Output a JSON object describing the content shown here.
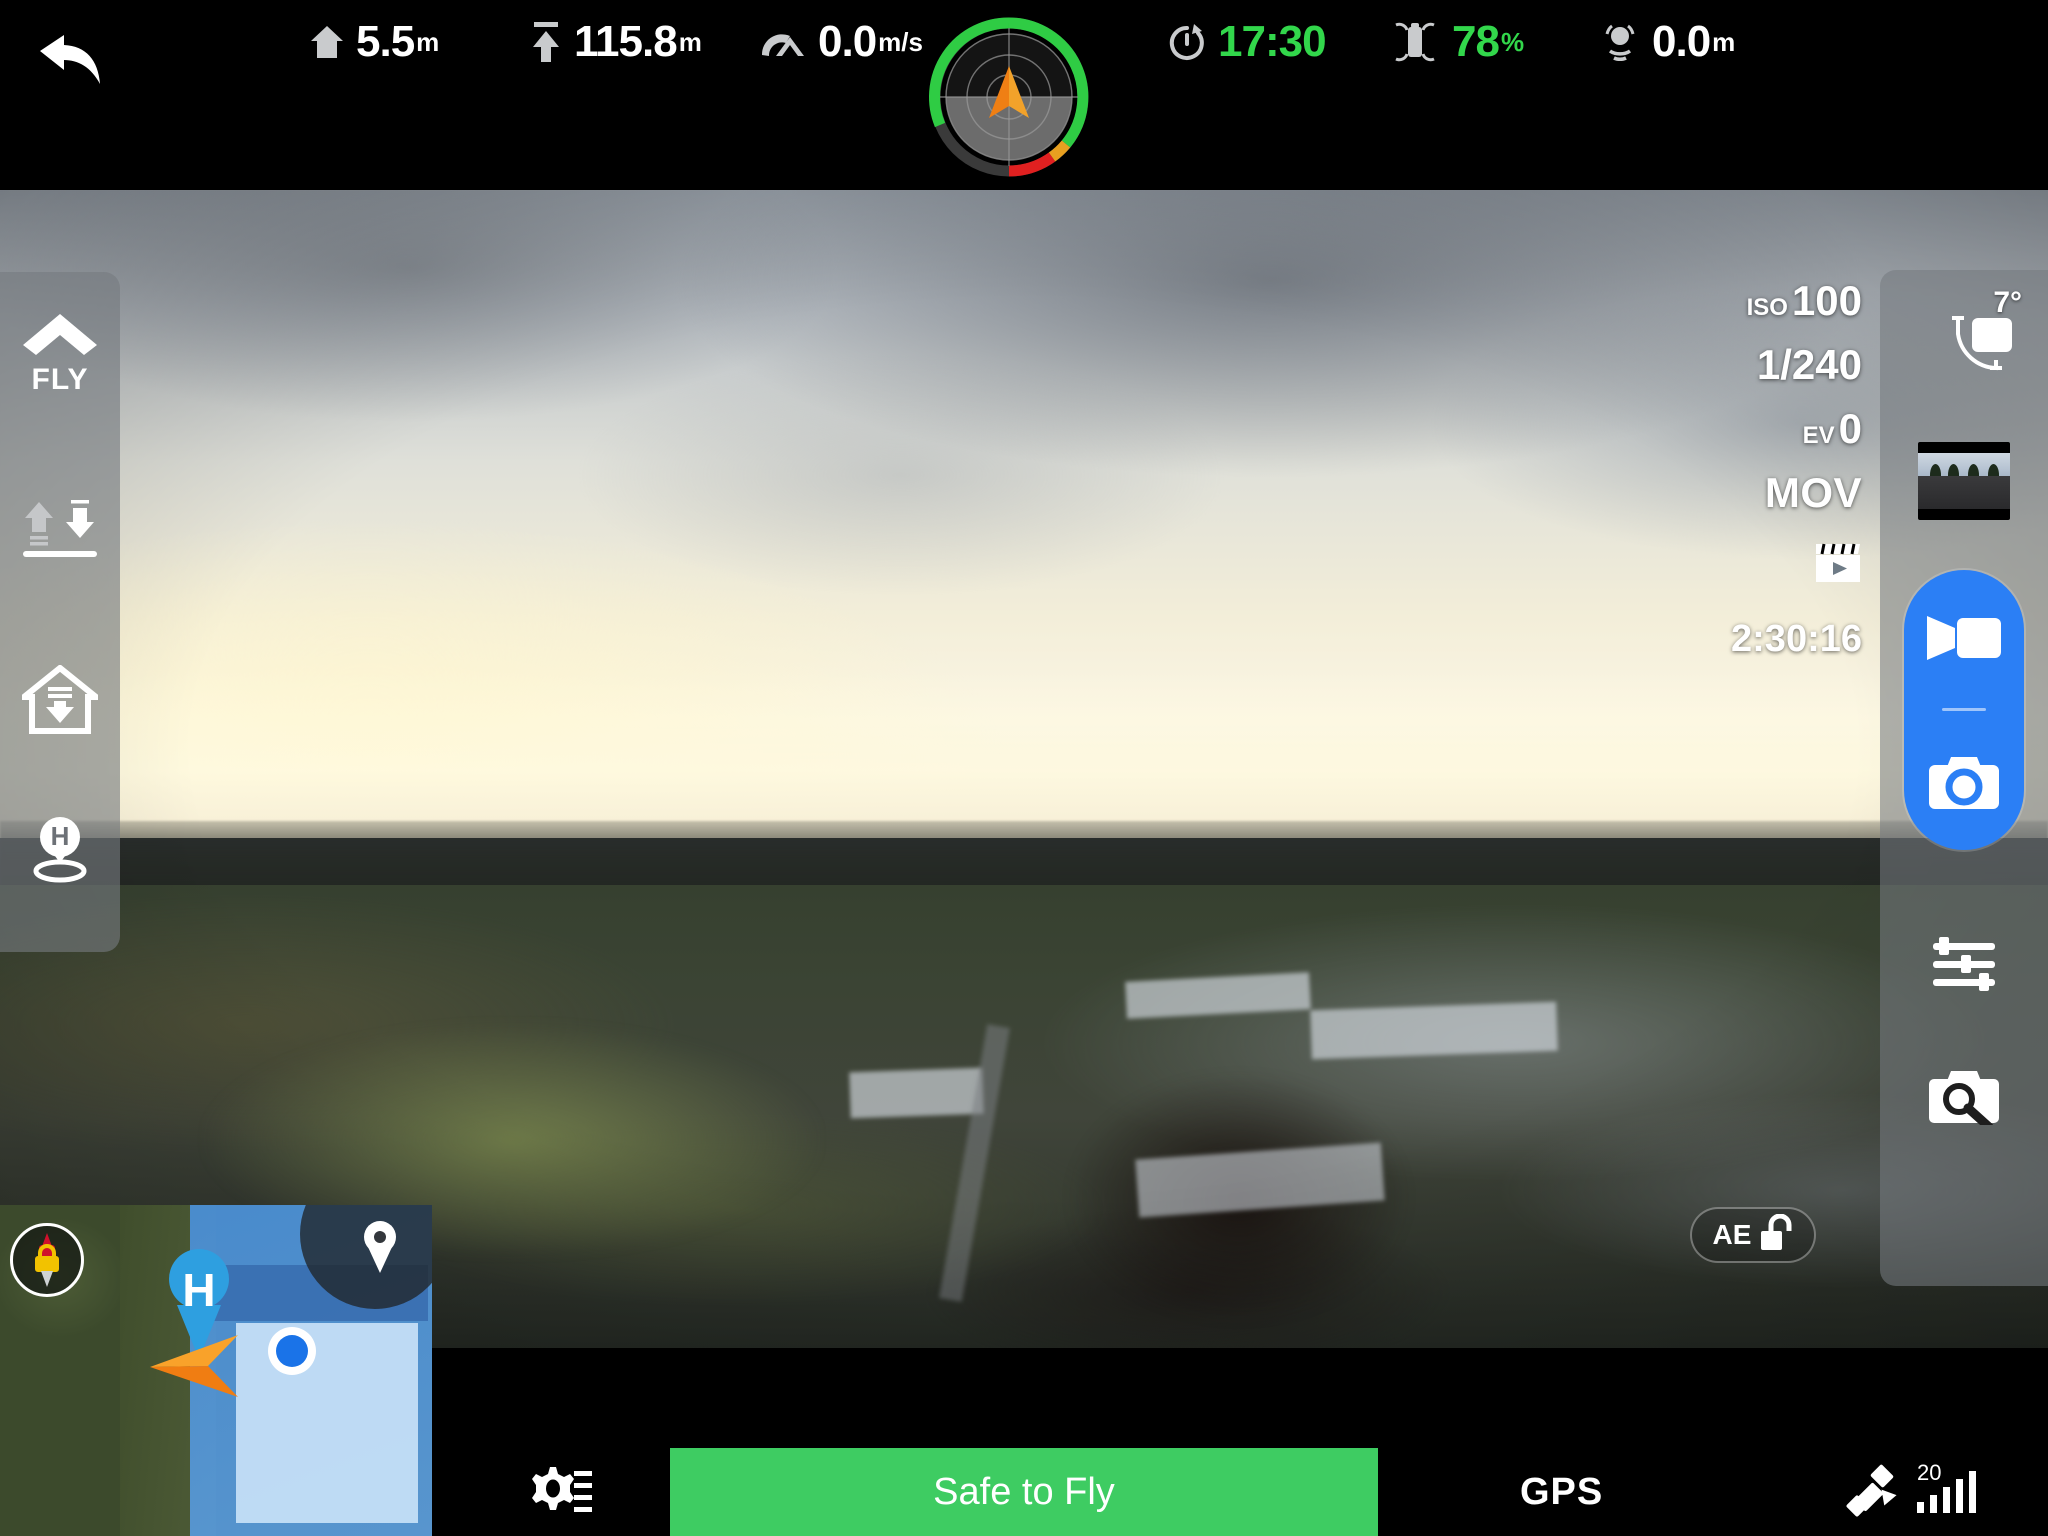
{
  "app": {
    "name": "drone-flight-controller",
    "accent_blue": "#2b7ff5",
    "status_green": "#3ecc62",
    "telemetry_green": "#32d74b"
  },
  "topbar": {
    "back_label": "back-arrow",
    "telemetry": [
      {
        "id": "home-distance",
        "icon": "house-icon",
        "value": "5.5",
        "unit": "m"
      },
      {
        "id": "altitude",
        "icon": "altitude-arrow-icon",
        "value": "115.8",
        "unit": "m"
      },
      {
        "id": "speed",
        "icon": "speedometer-icon",
        "value": "0.0",
        "unit": "m/s"
      },
      {
        "id": "flight-timer",
        "icon": "stopwatch-icon",
        "value": "17:30",
        "unit": ""
      },
      {
        "id": "battery",
        "icon": "drone-battery-icon",
        "value": "78",
        "unit": "%"
      },
      {
        "id": "vps-height",
        "icon": "vps-sensor-icon",
        "value": "0.0",
        "unit": "m"
      }
    ],
    "attitude": {
      "name": "attitude-radar-indicator",
      "heading_arrow": "aircraft-heading-arrow"
    }
  },
  "sidebar": {
    "items": [
      {
        "id": "fly-mode",
        "icon": "chevron-up-icon",
        "label": "FLY"
      },
      {
        "id": "auto-takeoff-landing",
        "icon": "takeoff-land-arrows-icon",
        "label": ""
      },
      {
        "id": "return-to-home",
        "icon": "home-return-icon",
        "label": ""
      },
      {
        "id": "home-point",
        "icon": "home-pin-h-icon",
        "label": ""
      }
    ]
  },
  "camera_info": {
    "iso_label": "ISO",
    "iso_value": "100",
    "shutter": "1/240",
    "ev_label": "EV",
    "ev_value": "0",
    "format": "MOV",
    "format_icon": "clapperboard-icon",
    "remaining_duration": "2:30:16"
  },
  "right_panel": {
    "gimbal": {
      "icon": "gimbal-camera-icon",
      "pitch": "7°"
    },
    "thumbnail": {
      "name": "media-thumbnail"
    },
    "record_button": {
      "icon": "video-camera-icon"
    },
    "photo_button": {
      "icon": "photo-camera-icon"
    },
    "adjust_button": {
      "icon": "sliders-icon"
    },
    "camera_settings_button": {
      "icon": "camera-wrench-icon"
    }
  },
  "ae_lock": {
    "label": "AE",
    "icon": "padlock-open-icon"
  },
  "minimap": {
    "lock_badge_icon": "compass-lock-icon",
    "pin_button_icon": "map-pin-icon",
    "home_marker_label": "H",
    "aircraft_marker_icon": "aircraft-arrow-icon",
    "user_location_icon": "user-location-dot"
  },
  "bottombar": {
    "settings_icon": "settings-sliders-icon",
    "status_text": "Safe to Fly",
    "gps_label": "GPS",
    "satellite_icon": "satellite-icon",
    "satellite_count": "20",
    "signal_bars": 5
  }
}
